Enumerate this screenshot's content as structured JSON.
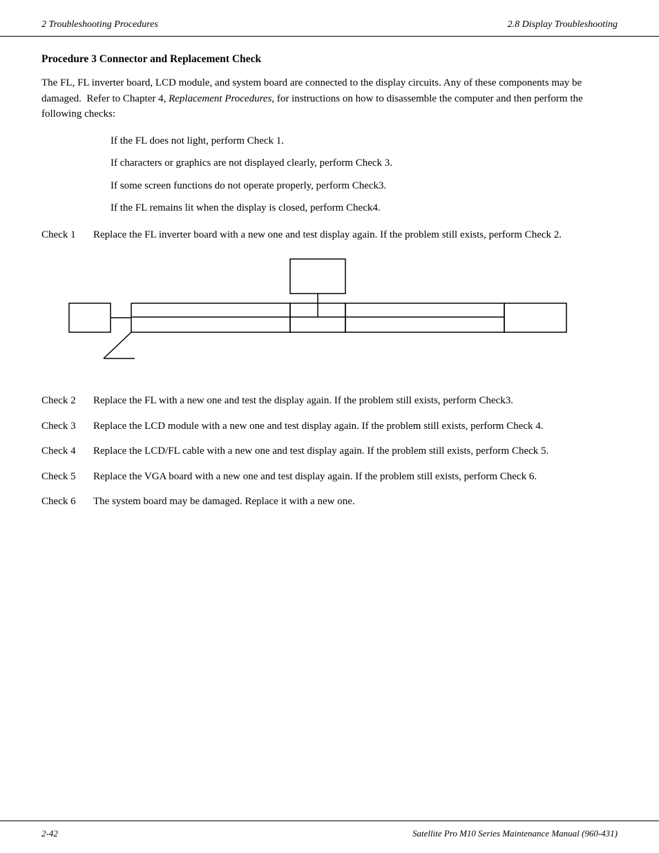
{
  "header": {
    "left": "2  Troubleshooting Procedures",
    "right": "2.8  Display Troubleshooting"
  },
  "footer": {
    "left": "2-42",
    "right": "Satellite Pro M10 Series Maintenance Manual (960-431)"
  },
  "procedure": {
    "title": "Procedure 3     Connector and Replacement Check",
    "intro": [
      "The FL, FL inverter board, LCD module, and system board are connected to the display circuits.",
      "Any of these components may be damaged.  Refer to Chapter 4, Replacement Procedures, for",
      "instructions on how to disassemble the computer and then perform the following checks:"
    ],
    "intro_italic": "Replacement Procedures,",
    "checklist": [
      "If the FL does not light, perform Check 1.",
      "If characters or graphics are not displayed clearly, perform Check 3.",
      "If some screen functions do not operate properly, perform Check3.",
      "If the FL remains lit when the display is closed, perform Check4."
    ],
    "checks": [
      {
        "label": "Check 1",
        "text": "Replace the FL inverter board with a new one and test display again.  If the problem still exists, perform Check 2."
      },
      {
        "label": "Check 2",
        "text": "Replace the FL with a new one and test the display again.  If the problem still exists, perform Check3."
      },
      {
        "label": "Check 3",
        "text": "Replace the LCD module with a new one and test display again.  If the problem still exists, perform Check 4."
      },
      {
        "label": "Check 4",
        "text": "Replace the LCD/FL cable with a new one and test display again.  If the problem still exists, perform Check 5."
      },
      {
        "label": "Check 5",
        "text": "Replace the VGA board with a new one and test display again.  If the problem still exists, perform Check 6."
      },
      {
        "label": "Check 6",
        "text": "The system board may be damaged.  Replace it with a new one."
      }
    ]
  }
}
